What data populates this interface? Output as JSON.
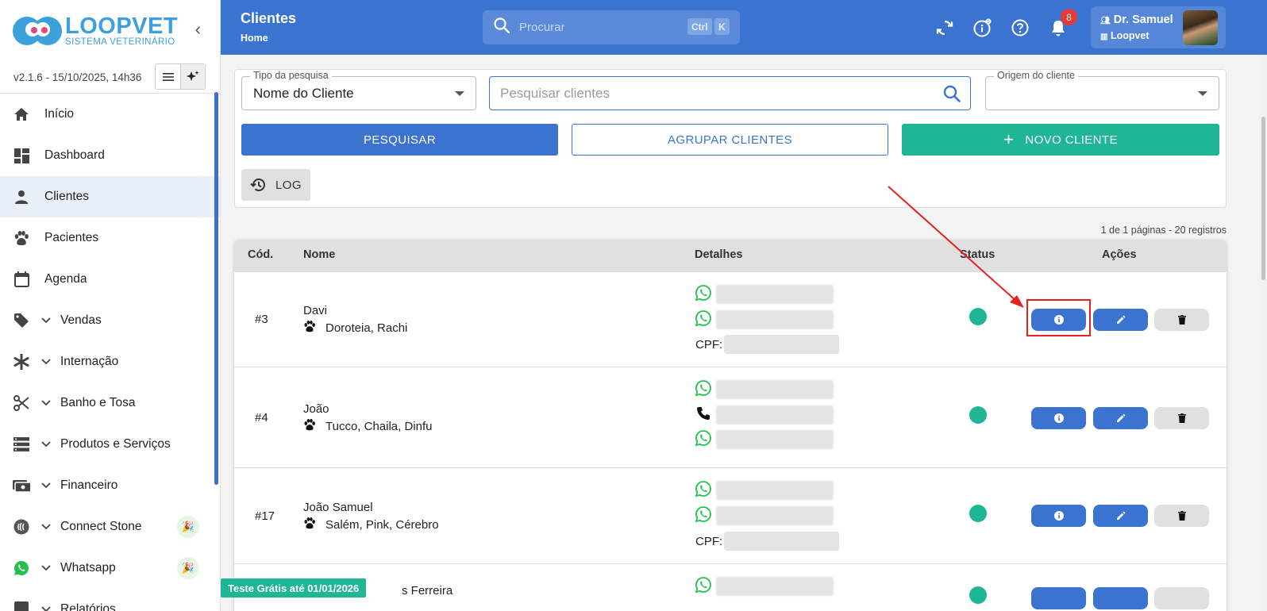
{
  "sidebar": {
    "logo_title": "LOOPVET",
    "logo_subtitle": "SISTEMA VETERINÁRIO",
    "version": "v2.1.6 - 15/10/2025, 14h36",
    "items": [
      {
        "label": "Início",
        "icon": "home-icon"
      },
      {
        "label": "Dashboard",
        "icon": "dashboard-icon"
      },
      {
        "label": "Clientes",
        "icon": "person-icon",
        "active": true
      },
      {
        "label": "Pacientes",
        "icon": "paw-icon"
      },
      {
        "label": "Agenda",
        "icon": "calendar-icon"
      },
      {
        "label": "Vendas",
        "icon": "tag-icon",
        "expandable": true
      },
      {
        "label": "Internação",
        "icon": "asterisk-icon",
        "expandable": true
      },
      {
        "label": "Banho e Tosa",
        "icon": "scissors-icon",
        "expandable": true
      },
      {
        "label": "Produtos e Serviços",
        "icon": "list-icon",
        "expandable": true
      },
      {
        "label": "Financeiro",
        "icon": "money-icon",
        "expandable": true
      },
      {
        "label": "Connect Stone",
        "icon": "nfc-icon",
        "expandable": true,
        "badge": "party-icon"
      },
      {
        "label": "Whatsapp",
        "icon": "whatsapp-icon",
        "expandable": true,
        "badge": "party-icon"
      },
      {
        "label": "Relatórios",
        "icon": "report-icon",
        "expandable": true
      }
    ]
  },
  "header": {
    "title": "Clientes",
    "breadcrumb": "Home",
    "search_placeholder": "Procurar",
    "shortcut_ctrl": "Ctrl",
    "shortcut_key": "K",
    "notification_count": "8",
    "user_name": "Dr. Samuel",
    "user_org": "Loopvet"
  },
  "filters": {
    "search_type_label": "Tipo da pesquisa",
    "search_type_value": "Nome do Cliente",
    "search_placeholder": "Pesquisar clientes",
    "origin_label": "Origem do cliente",
    "origin_value": "",
    "btn_search": "PESQUISAR",
    "btn_group": "AGRUPAR CLIENTES",
    "btn_new": "NOVO CLIENTE",
    "btn_log": "LOG"
  },
  "pagination": "1 de 1 páginas - 20 registros",
  "table": {
    "headers": {
      "cod": "Cód.",
      "name": "Nome",
      "details": "Detalhes",
      "status": "Status",
      "actions": "Ações"
    },
    "rows": [
      {
        "cod": "#3",
        "name": "Davi",
        "pets": "Doroteia,  Rachi",
        "cpf": "CPF:"
      },
      {
        "cod": "#4",
        "name": "João",
        "pets": "Tucco,  Chaila,  Dinfu",
        "cpf": ""
      },
      {
        "cod": "#17",
        "name": "João Samuel",
        "pets": "Salém,  Pink,  Cérebro",
        "cpf": "CPF:"
      },
      {
        "cod": "",
        "name": "s Ferreira",
        "pets": "",
        "cpf": ""
      }
    ]
  },
  "trial_banner": "Teste Grátis até 01/01/2026",
  "colors": {
    "primary": "#3b74d0",
    "green": "#1fb696",
    "annotation_red": "#e82020"
  }
}
